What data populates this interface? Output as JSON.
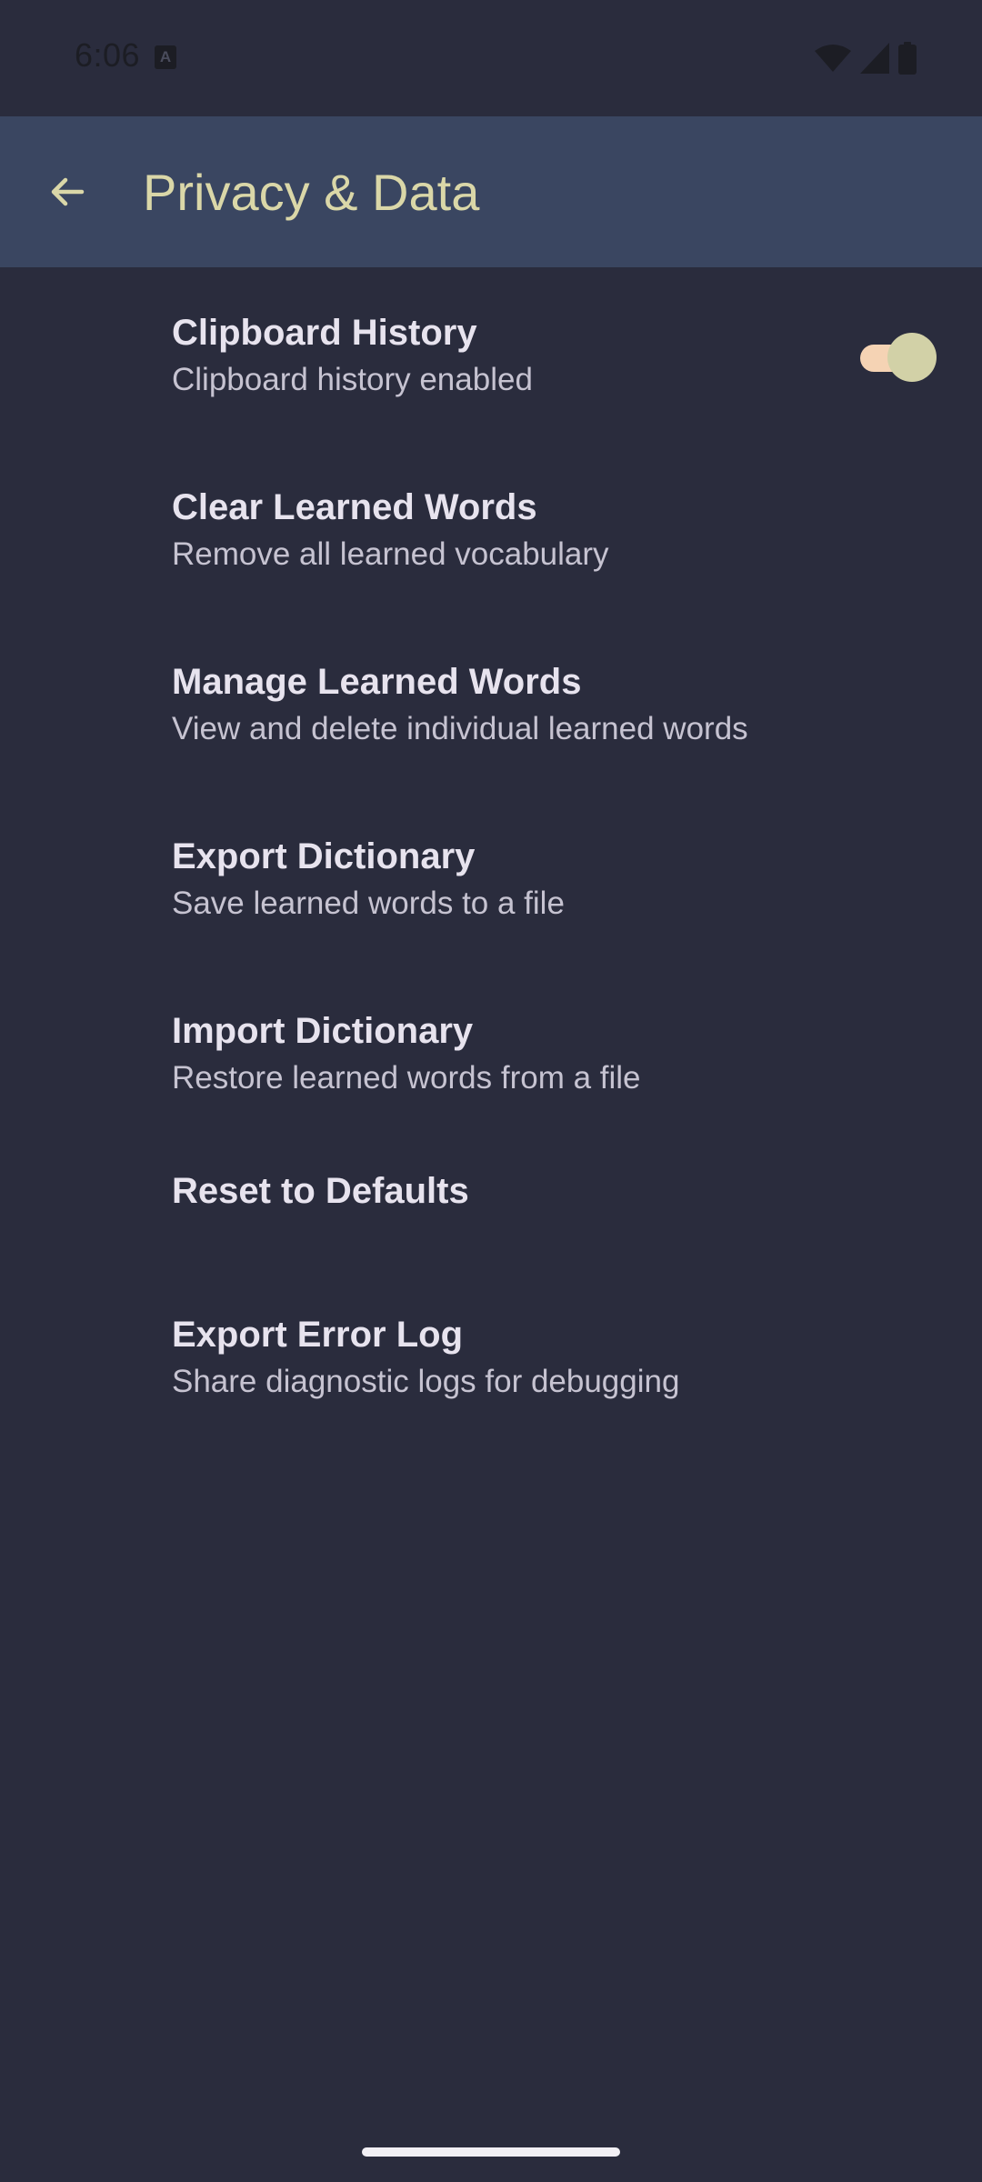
{
  "status_bar": {
    "time": "6:06",
    "notification_icon": "a-icon",
    "icons": [
      "wifi-icon",
      "cellular-signal-icon",
      "battery-icon"
    ]
  },
  "app_bar": {
    "back_icon": "arrow-left-icon",
    "title": "Privacy & Data"
  },
  "settings": {
    "items": [
      {
        "title": "Clipboard History",
        "summary": "Clipboard history enabled",
        "toggle": true
      },
      {
        "title": "Clear Learned Words",
        "summary": "Remove all learned vocabulary"
      },
      {
        "title": "Manage Learned Words",
        "summary": "View and delete individual learned words"
      },
      {
        "title": "Export Dictionary",
        "summary": "Save learned words to a file"
      },
      {
        "title": "Import Dictionary",
        "summary": "Restore learned words from a file"
      },
      {
        "title": "Reset to Defaults"
      },
      {
        "title": "Export Error Log",
        "summary": "Share diagnostic logs for debugging"
      }
    ]
  },
  "colors": {
    "background": "#2a2c3d",
    "app_bar": "#3a4661",
    "title_accent": "#dad7a8",
    "toggle_track": "#f5d3b4",
    "toggle_thumb": "#d2d1a7"
  }
}
